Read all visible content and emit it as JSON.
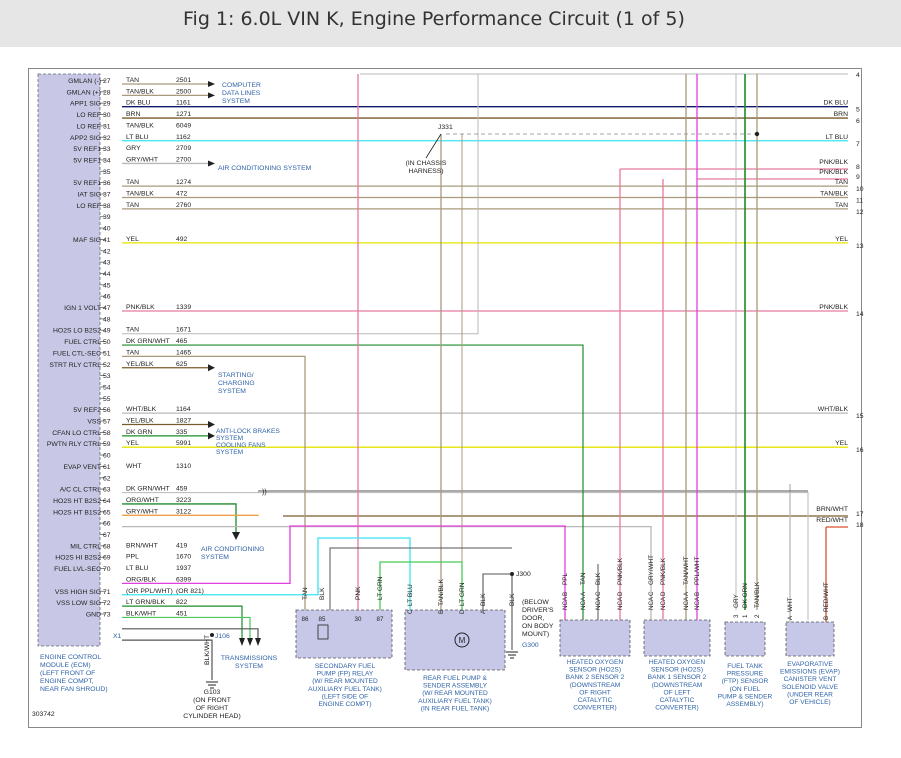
{
  "title": "Fig 1: 6.0L VIN K, Engine Performance Circuit (1 of 5)",
  "figure_code": "303742",
  "ecm": {
    "name_lines": [
      "ENGINE CONTROL",
      "MODULE (ECM)",
      "(LEFT FRONT OF",
      "ENGINE COMPT,",
      "NEAR FAN SHROUD)"
    ],
    "connector": "X1"
  },
  "pins": [
    {
      "pin": "27",
      "label": "GMLAN (-)",
      "color": "TAN",
      "circuit": "2501"
    },
    {
      "pin": "28",
      "label": "GMLAN (+)",
      "color": "TAN/BLK",
      "circuit": "2500"
    },
    {
      "pin": "29",
      "label": "APP1 SIG",
      "color": "DK BLU",
      "circuit": "1161"
    },
    {
      "pin": "30",
      "label": "LO REF",
      "color": "BRN",
      "circuit": "1271"
    },
    {
      "pin": "31",
      "label": "LO REF",
      "color": "TAN/BLK",
      "circuit": "6049"
    },
    {
      "pin": "32",
      "label": "APP2 SIG",
      "color": "LT BLU",
      "circuit": "1162"
    },
    {
      "pin": "33",
      "label": "5V REF1",
      "color": "GRY",
      "circuit": "2709"
    },
    {
      "pin": "34",
      "label": "5V REF1",
      "color": "GRY/WHT",
      "circuit": "2700"
    },
    {
      "pin": "35",
      "label": "",
      "color": "",
      "circuit": ""
    },
    {
      "pin": "36",
      "label": "5V REF1",
      "color": "TAN",
      "circuit": "1274"
    },
    {
      "pin": "37",
      "label": "IAT SIG",
      "color": "TAN/BLK",
      "circuit": "472"
    },
    {
      "pin": "38",
      "label": "LO REF",
      "color": "TAN",
      "circuit": "2760"
    },
    {
      "pin": "39",
      "label": "",
      "color": "",
      "circuit": ""
    },
    {
      "pin": "40",
      "label": "",
      "color": "",
      "circuit": ""
    },
    {
      "pin": "41",
      "label": "MAF SIG",
      "color": "YEL",
      "circuit": "492"
    },
    {
      "pin": "42",
      "label": "",
      "color": "",
      "circuit": ""
    },
    {
      "pin": "43",
      "label": "",
      "color": "",
      "circuit": ""
    },
    {
      "pin": "44",
      "label": "",
      "color": "",
      "circuit": ""
    },
    {
      "pin": "45",
      "label": "",
      "color": "",
      "circuit": ""
    },
    {
      "pin": "46",
      "label": "",
      "color": "",
      "circuit": ""
    },
    {
      "pin": "47",
      "label": "IGN 1 VOLT",
      "color": "PNK/BLK",
      "circuit": "1339"
    },
    {
      "pin": "48",
      "label": "",
      "color": "",
      "circuit": ""
    },
    {
      "pin": "49",
      "label": "HO2S LO B2S2",
      "color": "TAN",
      "circuit": "1671"
    },
    {
      "pin": "50",
      "label": "FUEL CTRL",
      "color": "DK GRN/WHT",
      "circuit": "465"
    },
    {
      "pin": "51",
      "label": "FUEL CTL-SEC",
      "color": "TAN",
      "circuit": "1465"
    },
    {
      "pin": "52",
      "label": "STRT RLY CTRL",
      "color": "YEL/BLK",
      "circuit": "625"
    },
    {
      "pin": "53",
      "label": "",
      "color": "",
      "circuit": ""
    },
    {
      "pin": "54",
      "label": "",
      "color": "",
      "circuit": ""
    },
    {
      "pin": "55",
      "label": "",
      "color": "",
      "circuit": ""
    },
    {
      "pin": "56",
      "label": "5V REF2",
      "color": "WHT/BLK",
      "circuit": "1164"
    },
    {
      "pin": "57",
      "label": "VSS",
      "color": "YEL/BLK",
      "circuit": "1827"
    },
    {
      "pin": "58",
      "label": "CFAN LO CTRL",
      "color": "DK GRN",
      "circuit": "335"
    },
    {
      "pin": "59",
      "label": "PWTN RLY CTRL",
      "color": "YEL",
      "circuit": "5991"
    },
    {
      "pin": "60",
      "label": "",
      "color": "",
      "circuit": ""
    },
    {
      "pin": "61",
      "label": "EVAP VENT",
      "color": "WHT",
      "circuit": "1310"
    },
    {
      "pin": "62",
      "label": "",
      "color": "",
      "circuit": ""
    },
    {
      "pin": "63",
      "label": "A/C CL CTRL",
      "color": "DK GRN/WHT",
      "circuit": "459"
    },
    {
      "pin": "64",
      "label": "HO2S HT B2S2",
      "color": "ORG/WHT",
      "circuit": "3223"
    },
    {
      "pin": "65",
      "label": "HO2S HT B1S2",
      "color": "GRY/WHT",
      "circuit": "3122"
    },
    {
      "pin": "66",
      "label": "",
      "color": "",
      "circuit": ""
    },
    {
      "pin": "67",
      "label": "",
      "color": "",
      "circuit": ""
    },
    {
      "pin": "68",
      "label": "MIL CTRL",
      "color": "BRN/WHT",
      "circuit": "419"
    },
    {
      "pin": "69",
      "label": "HO2S HI B2S2",
      "color": "PPL",
      "circuit": "1670"
    },
    {
      "pin": "70",
      "label": "FUEL LVL-SEC",
      "color": "LT BLU",
      "circuit": "1937"
    },
    {
      "pin": "",
      "label": "",
      "color": "ORG/BLK",
      "circuit": "6399"
    },
    {
      "pin": "71",
      "label": "VSS HIGH SIG",
      "color": "(OR PPL/WHT)",
      "circuit": "(OR 821)"
    },
    {
      "pin": "72",
      "label": "VSS LOW SIG",
      "color": "LT GRN/BLK",
      "circuit": "822"
    },
    {
      "pin": "73",
      "label": "GND",
      "color": "BLK/WHT",
      "circuit": "451"
    }
  ],
  "right_terminals": [
    {
      "num": "4",
      "wire": ""
    },
    {
      "num": "5",
      "wire": "DK BLU"
    },
    {
      "num": "6",
      "wire": "BRN"
    },
    {
      "num": "7",
      "wire": "LT BLU"
    },
    {
      "num": "8",
      "wire": "PNK/BLK"
    },
    {
      "num": "9",
      "wire": "PNK/BLK"
    },
    {
      "num": "10",
      "wire": "TAN"
    },
    {
      "num": "11",
      "wire": "TAN/BLK"
    },
    {
      "num": "12",
      "wire": "TAN"
    },
    {
      "num": "13",
      "wire": "YEL"
    },
    {
      "num": "14",
      "wire": "PNK/BLK"
    },
    {
      "num": "15",
      "wire": "WHT/BLK"
    },
    {
      "num": "16",
      "wire": "YEL"
    },
    {
      "num": "17",
      "wire": "BRN/WHT"
    },
    {
      "num": "18",
      "wire": "RED/WHT"
    }
  ],
  "systems": {
    "computer_data_lines": [
      "COMPUTER",
      "DATA LINES",
      "SYSTEM"
    ],
    "air_conditioning_1": "AIR CONDITIONING SYSTEM",
    "starting_charging": [
      "STARTING/",
      "CHARGING",
      "SYSTEM"
    ],
    "anti_lock": [
      "ANTI-LOCK BRAKES",
      "SYSTEM"
    ],
    "cooling_fans": [
      "COOLING FANS",
      "SYSTEM"
    ],
    "air_conditioning_2": [
      "AIR CONDITIONING",
      "SYSTEM"
    ],
    "transmissions": [
      "TRANSMISSIONS",
      "SYSTEM"
    ]
  },
  "splices": {
    "j331": "J331",
    "j331_note": [
      "(IN CHASSIS",
      "HARNESS)"
    ],
    "j300": "J300",
    "j106": "J106"
  },
  "grounds": {
    "g103_wire": "BLK/WHT",
    "g103": [
      "G103",
      "(ON FRONT",
      "OF RIGHT",
      "CYLINDER HEAD)"
    ],
    "g300_note": [
      "(BELOW",
      "DRIVER'S",
      "DOOR,",
      "ON BODY",
      "MOUNT)"
    ],
    "g300": "G300"
  },
  "components": {
    "relay": {
      "wires": [
        "TAN",
        "BLK",
        "PNK",
        "LT GRN"
      ],
      "pins": [
        "86",
        "85",
        "30",
        "87"
      ],
      "name": [
        "SECONDARY FUEL",
        "PUMP (FP) RELAY",
        "(W/ REAR MOUNTED",
        "AUXILIARY FUEL TANK)",
        "(LEFT SIDE OF",
        "ENGINE COMPT)"
      ]
    },
    "fuel_pump": {
      "wires": [
        "LT BLU",
        "TAN/BLK",
        "LT GRN",
        "BLK",
        "BLK"
      ],
      "pins": [
        "C",
        "B",
        "D",
        "A"
      ],
      "name": [
        "REAR FUEL PUMP &",
        "SENDER ASSEMBLY",
        "(W/ REAR MOUNTED",
        "AUXILIARY FUEL TANK)",
        "(IN REAR FUEL TANK)"
      ]
    },
    "ho2s_b2s2": {
      "wires": [
        "PPL",
        "TAN",
        "BLK",
        "PNK/BLK"
      ],
      "pins": [
        "B",
        "A",
        "C",
        "D"
      ],
      "nca": "NCA",
      "name": [
        "HEATED OXYGEN",
        "SENSOR (HO2S)",
        "BANK 2 SENSOR 2",
        "(DOWNSTREAM",
        "OF RIGHT",
        "CATALYTIC",
        "CONVERTER)"
      ]
    },
    "ho2s_b1s2": {
      "wires": [
        "GRY/WHT",
        "PNK/BLK",
        "TAN/WHT",
        "PPL/WHT"
      ],
      "pins": [
        "C",
        "D",
        "A",
        "B"
      ],
      "nca": "NCA",
      "name": [
        "HEATED OXYGEN",
        "SENSOR (HO2S)",
        "BANK 1 SENSOR 2",
        "(DOWNSTREAM",
        "OF LEFT",
        "CATALYTIC",
        "CONVERTER)"
      ]
    },
    "ftp": {
      "wires": [
        "GRY",
        "DK GRN",
        "TAN/BLK"
      ],
      "pins": [
        "3",
        "1",
        "2"
      ],
      "name": [
        "FUEL TANK",
        "PRESSURE",
        "(FTP) SENSOR",
        "(ON FUEL",
        "PUMP & SENDER",
        "ASSEMBLY)"
      ]
    },
    "evap": {
      "wires": [
        "WHT",
        "RED/WHT"
      ],
      "pins": [
        "A",
        "B"
      ],
      "name": [
        "EVAPORATIVE",
        "EMISSIONS (EVAP)",
        "CANISTER VENT",
        "SOLENOID VALVE",
        "(UNDER REAR",
        "OF VEHICLE)"
      ]
    }
  },
  "colors": {
    "tan": "#a89a7a",
    "brown": "#7a5a2a",
    "dk_blue": "#10186a",
    "lt_blue": "#38e4f0",
    "yellow": "#e4e400",
    "pink": "#e87aa0",
    "purple": "#e33ee0",
    "dk_green": "#1d8b2a",
    "lt_green": "#46c956",
    "orange": "#f0a04a",
    "red": "#d65030",
    "gray": "#b8b8b8",
    "ecm_fill": "#c8c8e6",
    "component_fill": "#c7c8e8",
    "label_blue": "#2f63a8"
  }
}
